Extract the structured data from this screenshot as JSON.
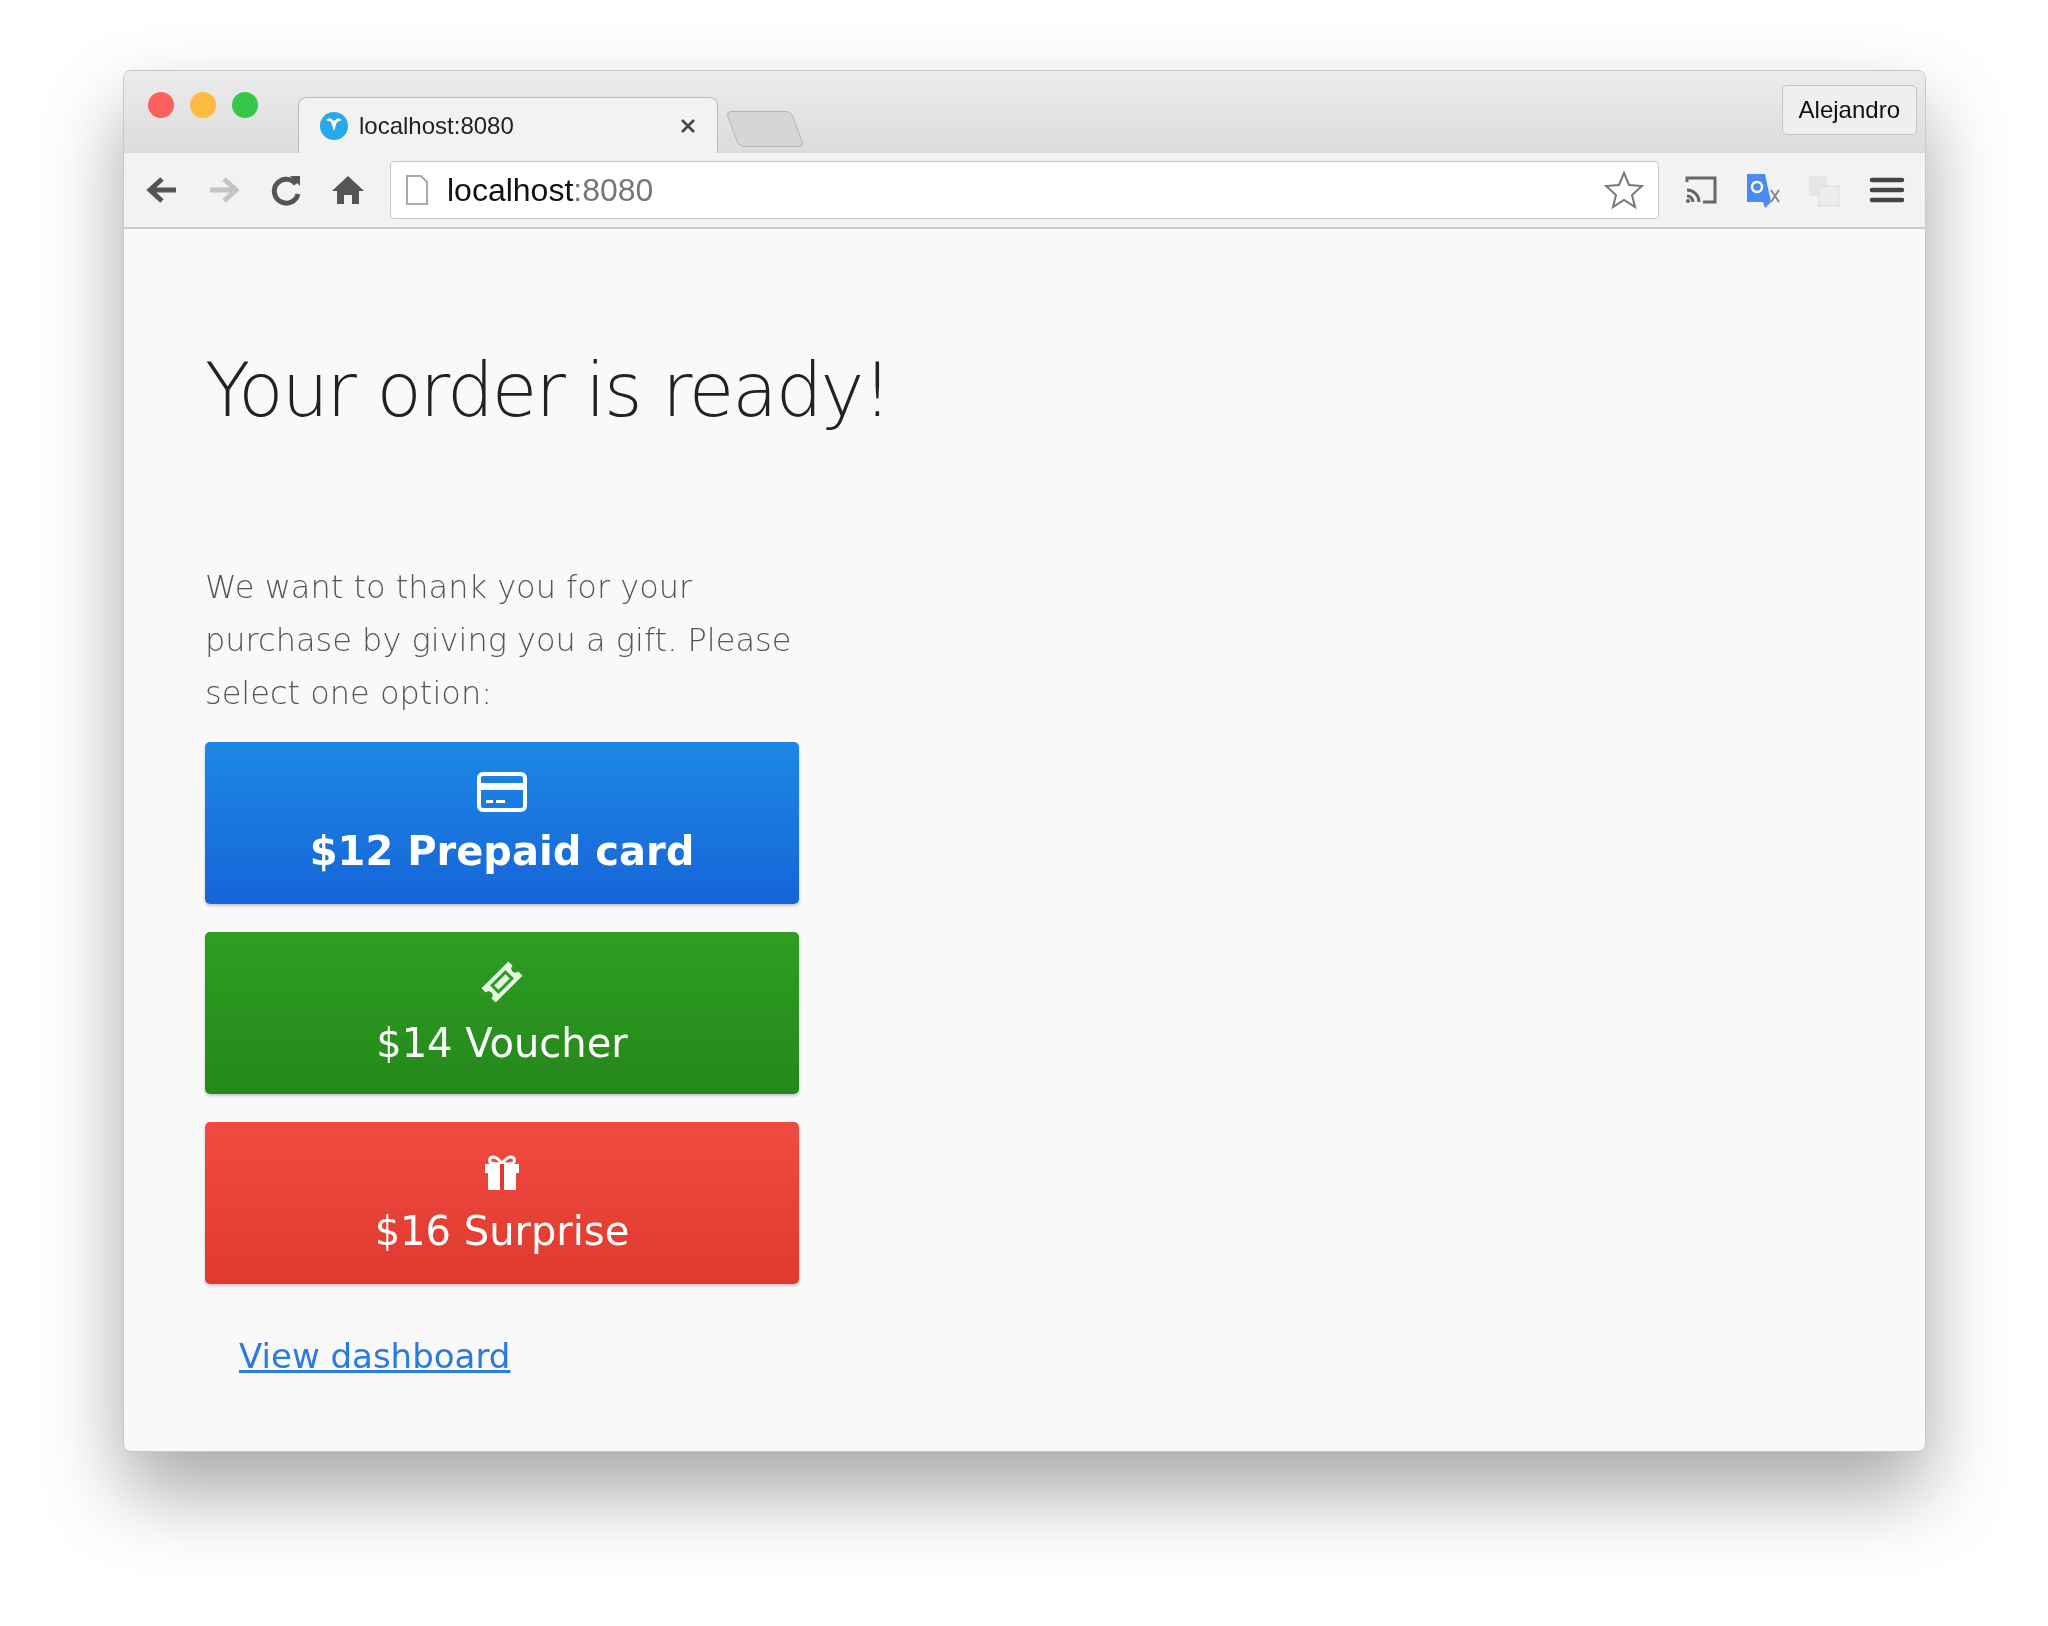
{
  "browser": {
    "tabs": [
      {
        "title": "localhost:8080",
        "selected": true
      }
    ],
    "profile": "Alejandro",
    "address": {
      "host": "localhost",
      "port": ":8080"
    }
  },
  "page": {
    "heading": "Your order is ready!",
    "intro": "We want to thank you for your purchase by giving you a gift. Please select one option:",
    "options": [
      {
        "kind": "card",
        "label": "$12 Prepaid card",
        "selected": true
      },
      {
        "kind": "voucher",
        "label": "$14 Voucher",
        "selected": false
      },
      {
        "kind": "gift",
        "label": "$16 Surprise",
        "selected": false
      }
    ],
    "link": "View dashboard"
  }
}
